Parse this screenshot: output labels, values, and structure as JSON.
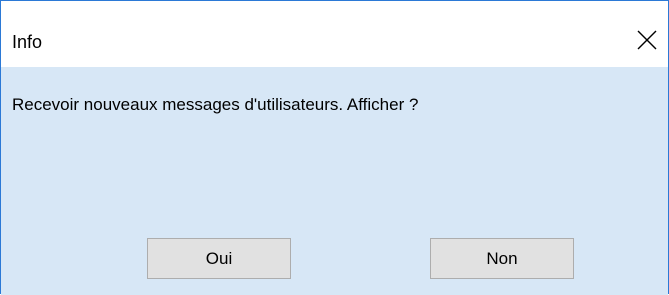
{
  "dialog": {
    "title": "Info",
    "close_icon": "close-icon",
    "message": "Recevoir nouveaux messages d'utilisateurs. Afficher ?",
    "buttons": {
      "yes_label": "Oui",
      "no_label": "Non"
    }
  },
  "colors": {
    "border": "#2b79d6",
    "content_background": "#d7e7f6",
    "titlebar_background": "#ffffff",
    "button_background": "#e1e1e1",
    "button_border": "#adadad"
  }
}
